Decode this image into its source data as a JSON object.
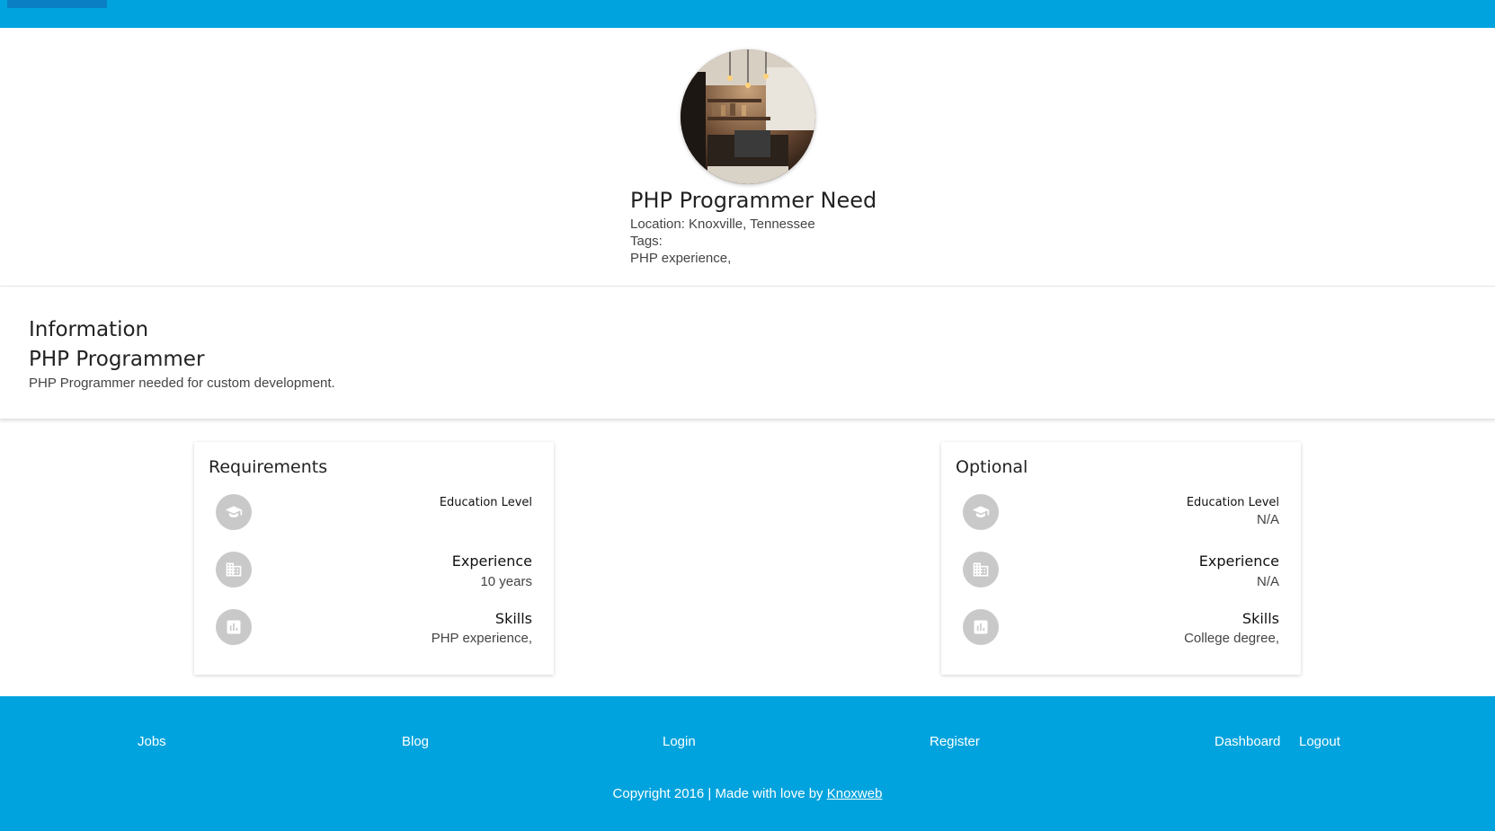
{
  "colors": {
    "primary": "#00a3dd",
    "primary_dark": "#0b7fc4",
    "icon_circle": "#c9c9c9"
  },
  "header": {
    "title": "PHP Programmer Need",
    "location": "Location: Knoxville, Tennessee",
    "tags_label": "Tags:",
    "tags": "PHP experience,"
  },
  "information": {
    "heading": "Information",
    "subtitle": "PHP Programmer",
    "description": "PHP Programmer needed for custom development."
  },
  "requirements": {
    "title": "Requirements",
    "education": {
      "label": "Education Level",
      "value": "",
      "icon": "graduation-cap-icon"
    },
    "experience": {
      "label": "Experience",
      "value": "10 years",
      "icon": "building-icon"
    },
    "skills": {
      "label": "Skills",
      "value": "PHP experience,",
      "icon": "bar-chart-icon"
    }
  },
  "optional": {
    "title": "Optional",
    "education": {
      "label": "Education Level",
      "value": "N/A",
      "icon": "graduation-cap-icon"
    },
    "experience": {
      "label": "Experience",
      "value": "N/A",
      "icon": "building-icon"
    },
    "skills": {
      "label": "Skills",
      "value": "College degree,",
      "icon": "bar-chart-icon"
    }
  },
  "footer": {
    "links": [
      "Jobs",
      "Blog",
      "Login",
      "Register",
      "Dashboard",
      "Logout"
    ],
    "copyright_prefix": "Copyright 2016 | Made with love by ",
    "copyright_link": "Knoxweb"
  }
}
